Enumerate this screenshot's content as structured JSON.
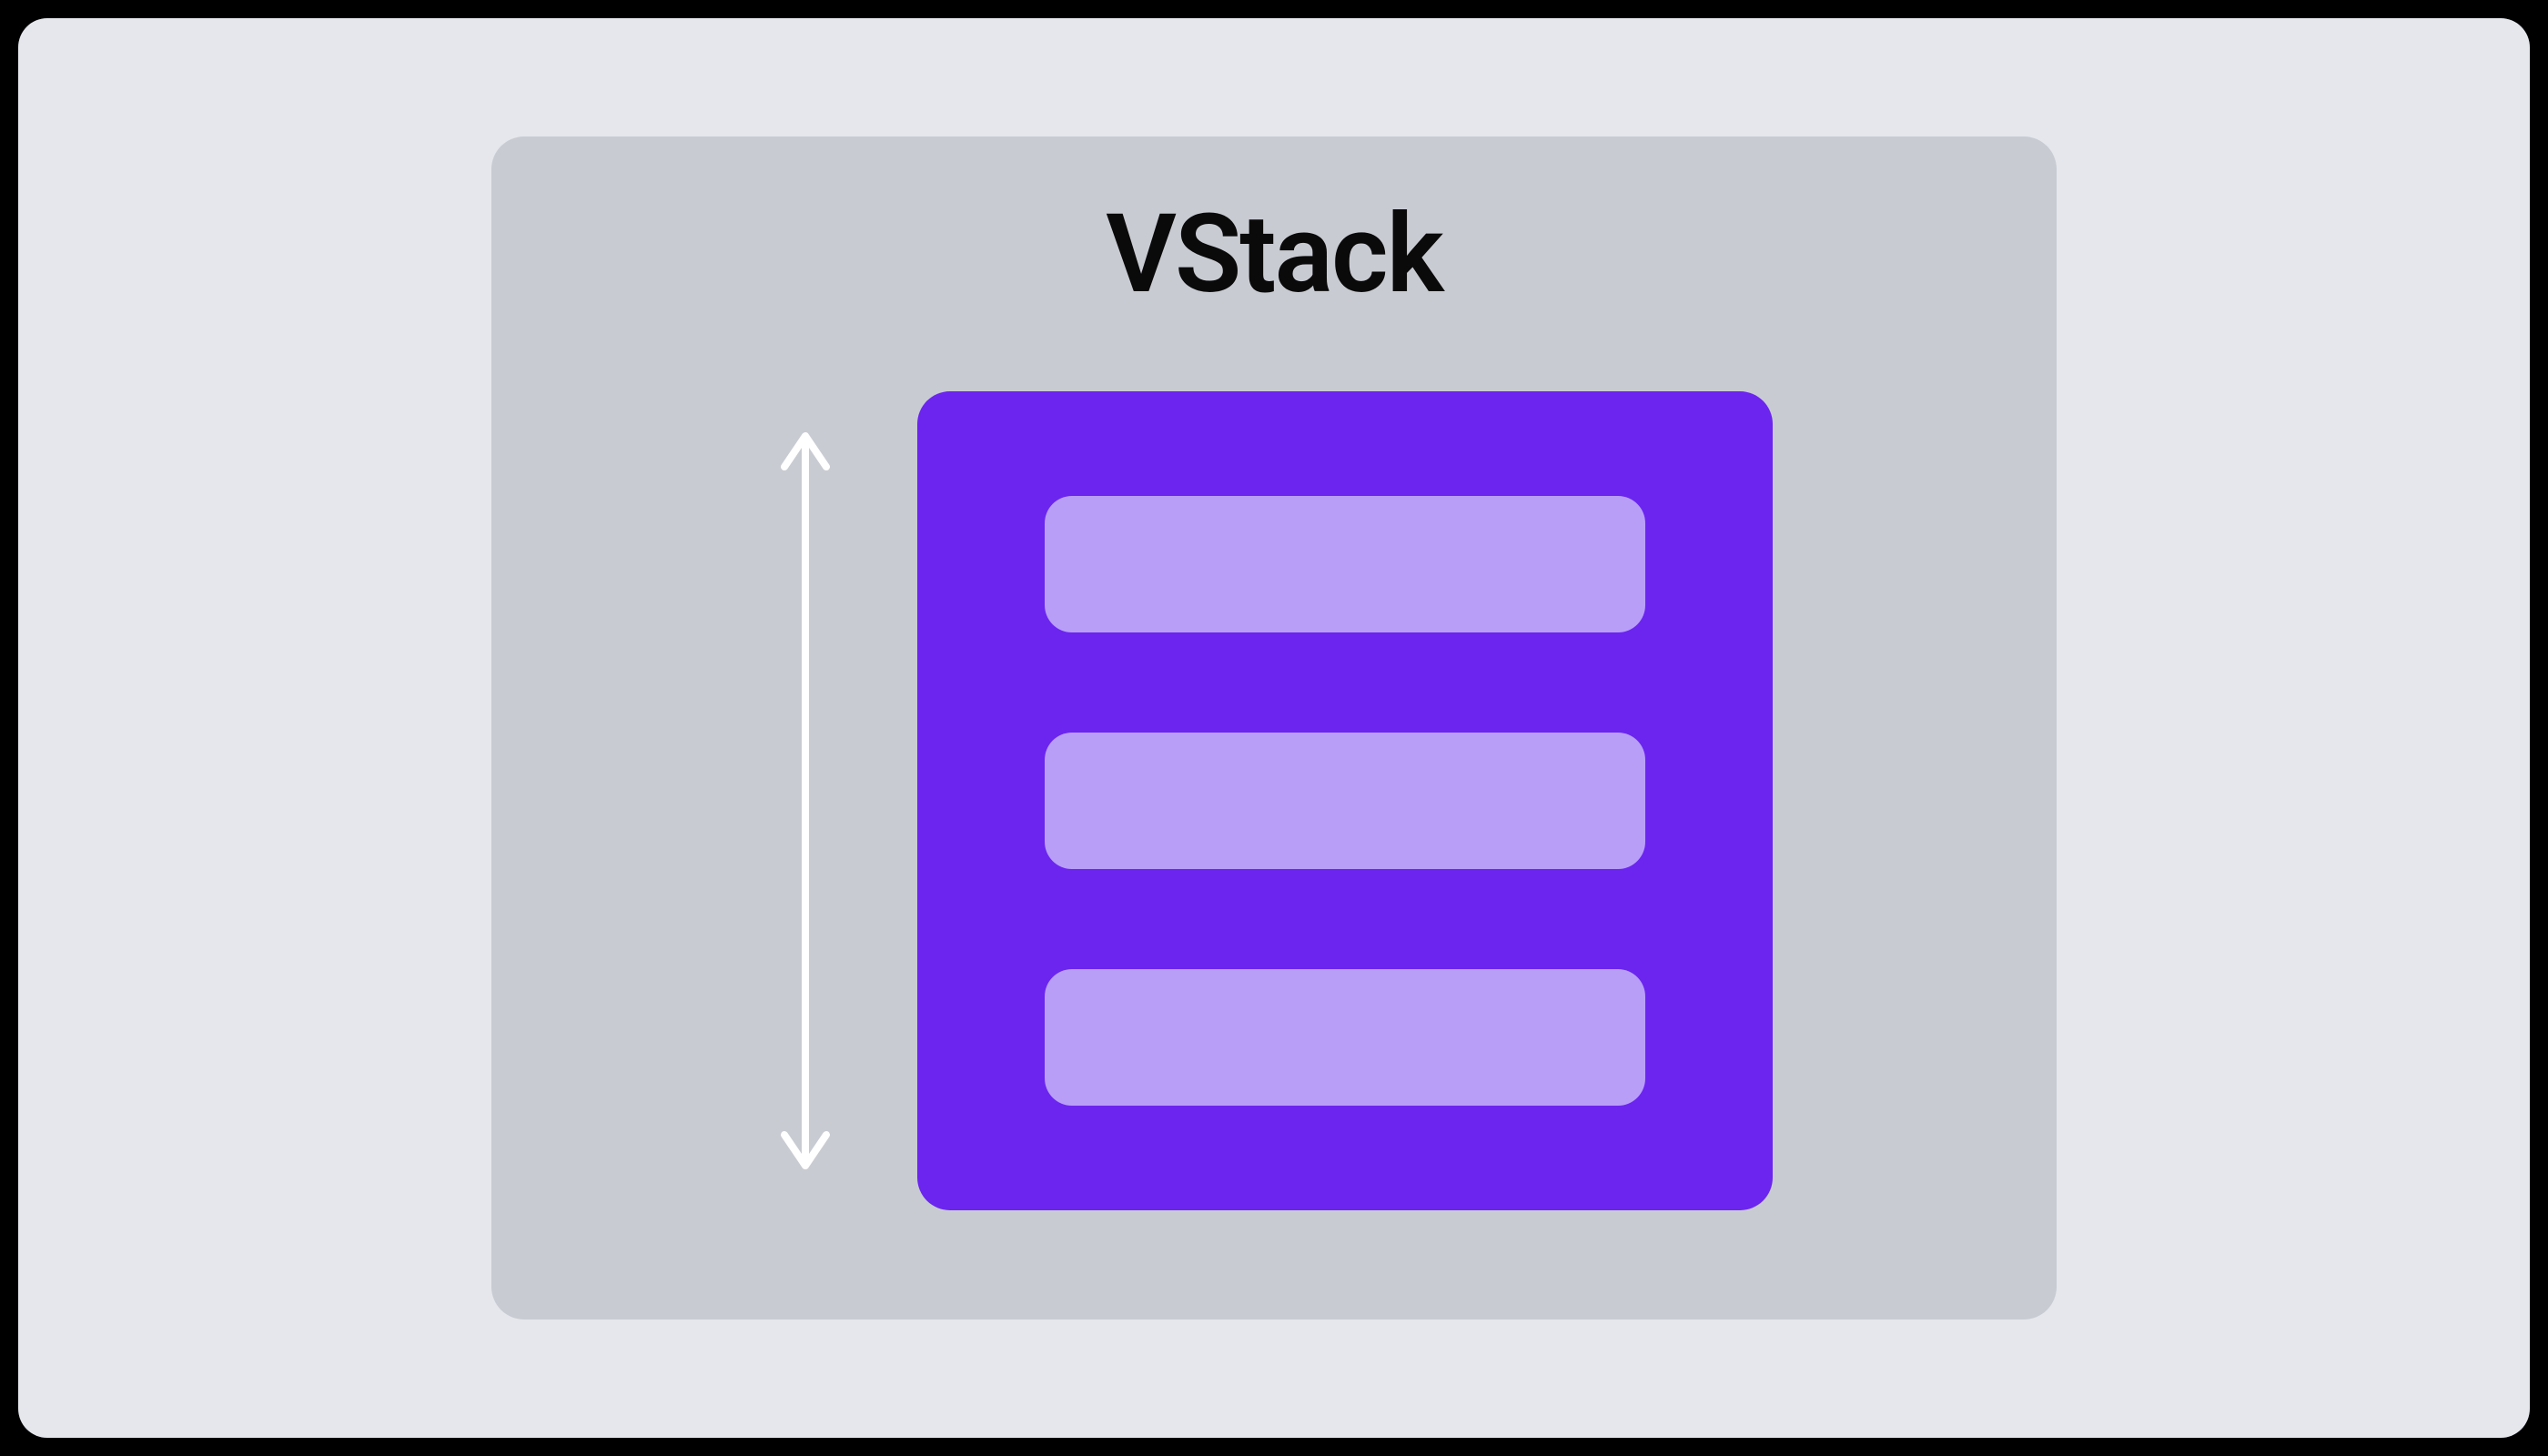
{
  "diagram": {
    "title": "VStack",
    "colors": {
      "page_bg": "#e5e7ed",
      "card_bg": "#c9cbd3",
      "container_bg": "#6b25ef",
      "item_bg": "#b99ef8",
      "arrow_color": "#ffffff",
      "title_color": "#0a0a0a"
    },
    "items_count": 3,
    "layout": "vertical",
    "arrow_direction": "vertical-double"
  }
}
